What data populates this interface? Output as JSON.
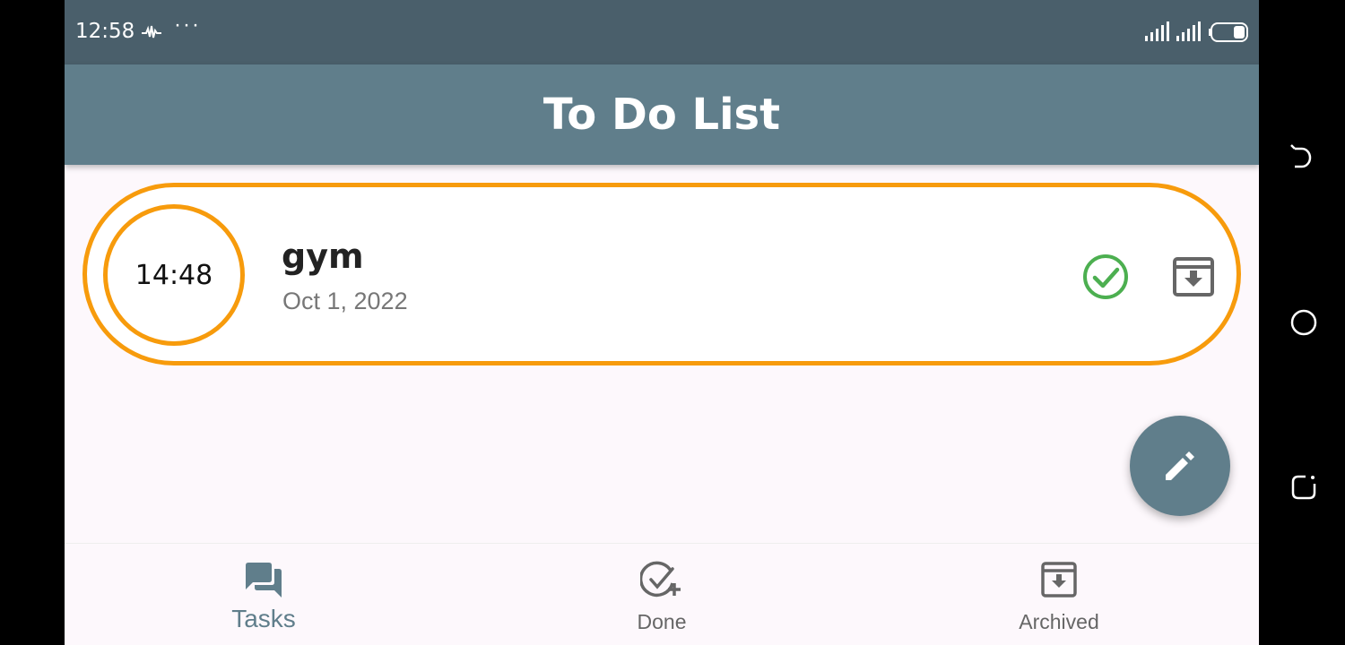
{
  "status_bar": {
    "time": "12:58",
    "dots": "···"
  },
  "app_bar": {
    "title": "To Do List"
  },
  "task": {
    "time": "14:48",
    "title": "gym",
    "date": "Oct 1, 2022"
  },
  "colors": {
    "accent": "#f79b0c",
    "primary": "#607e8b",
    "done_green": "#4caf50"
  },
  "bottom_nav": {
    "items": [
      {
        "label": "Tasks",
        "icon": "chat-bubbles-icon",
        "active": true
      },
      {
        "label": "Done",
        "icon": "check-circle-plus-icon",
        "active": false
      },
      {
        "label": "Archived",
        "icon": "archive-icon",
        "active": false
      }
    ]
  },
  "fab": {
    "icon": "pencil-icon"
  }
}
